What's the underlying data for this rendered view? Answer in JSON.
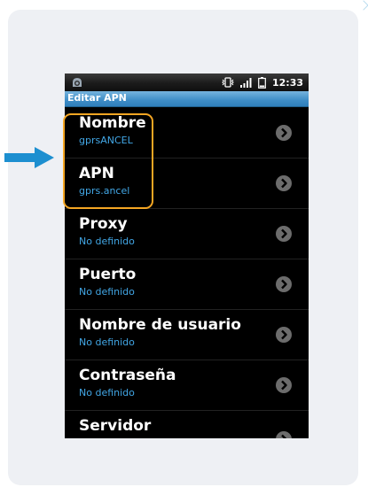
{
  "status_bar": {
    "time": "12:33",
    "left_icon": "android-notification-icon",
    "right_icons": [
      "vibrate-icon",
      "signal-bars-icon",
      "battery-icon"
    ]
  },
  "title_bar": {
    "title": "Editar APN"
  },
  "settings": [
    {
      "title": "Nombre",
      "value": "gprsANCEL"
    },
    {
      "title": "APN",
      "value": "gprs.ancel"
    },
    {
      "title": "Proxy",
      "value": "No definido"
    },
    {
      "title": "Puerto",
      "value": "No definido"
    },
    {
      "title": "Nombre de usuario",
      "value": "No definido"
    },
    {
      "title": "Contraseña",
      "value": "No definido"
    },
    {
      "title": "Servidor",
      "value": ""
    }
  ],
  "colors": {
    "highlight": "#f5a623",
    "pointer_arrow": "#1d8fd0",
    "value_text": "#42a7e6",
    "title_bar": "#3e8dc6"
  }
}
